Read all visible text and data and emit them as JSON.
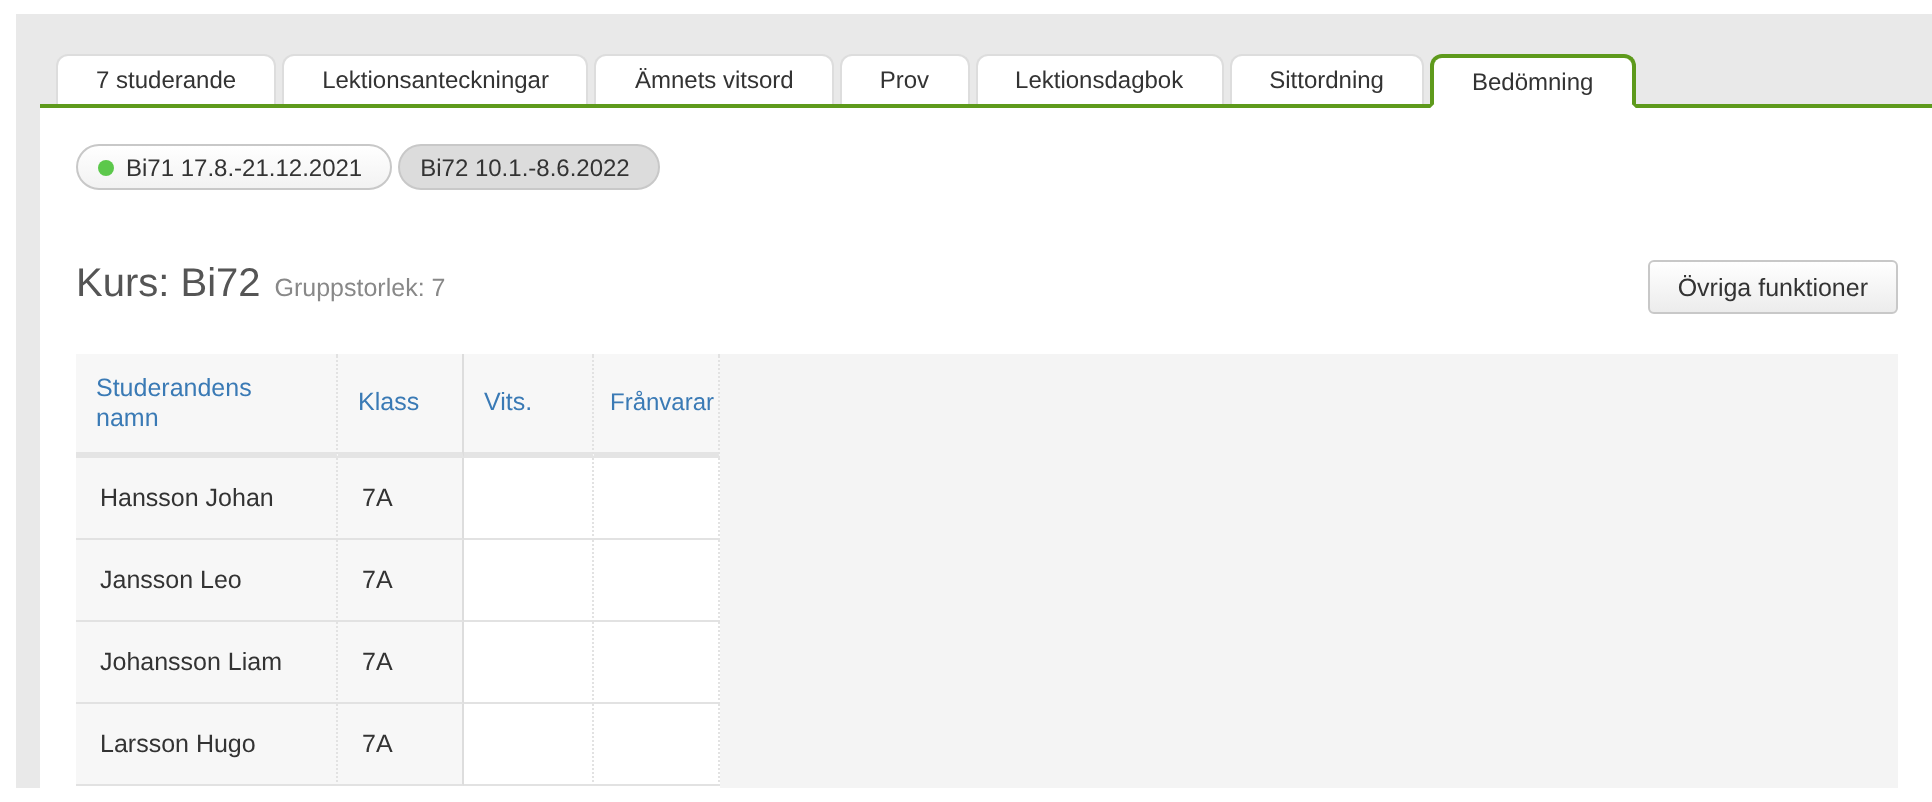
{
  "tabs": [
    {
      "label": "7 studerande",
      "selected": false
    },
    {
      "label": "Lektionsanteckningar",
      "selected": false
    },
    {
      "label": "Ämnets vitsord",
      "selected": false
    },
    {
      "label": "Prov",
      "selected": false
    },
    {
      "label": "Lektionsdagbok",
      "selected": false
    },
    {
      "label": "Sittordning",
      "selected": false
    },
    {
      "label": "Bedömning",
      "selected": true
    }
  ],
  "courses": [
    {
      "label": "Bi71 17.8.-21.12.2021",
      "active": true,
      "selected": false
    },
    {
      "label": "Bi72 10.1.-8.6.2022",
      "active": false,
      "selected": true
    }
  ],
  "heading": {
    "title": "Kurs: Bi72",
    "subtitle": "Gruppstorlek: 7"
  },
  "actions_button": "Övriga funktioner",
  "table": {
    "columns": [
      "Studerandens namn",
      "Klass",
      "Vits.",
      "Frånvarar"
    ],
    "rows": [
      [
        "Hansson Johan",
        "7A",
        "",
        ""
      ],
      [
        "Jansson Leo",
        "7A",
        "",
        ""
      ],
      [
        "Johansson Liam",
        "7A",
        "",
        ""
      ],
      [
        "Larsson Hugo",
        "7A",
        "",
        ""
      ]
    ]
  }
}
